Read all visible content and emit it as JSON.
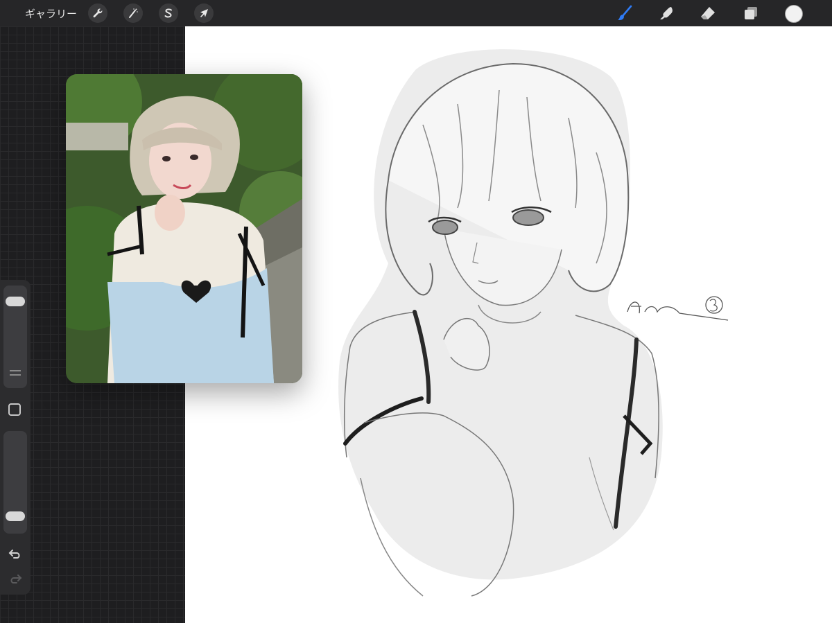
{
  "app": {
    "gallery_label": "ギャラリー"
  },
  "toolbar_left": [
    {
      "name": "actions-button",
      "icon": "wrench-icon"
    },
    {
      "name": "adjustments-button",
      "icon": "magic-wand-icon"
    },
    {
      "name": "selection-button",
      "icon": "selection-s-icon"
    },
    {
      "name": "transform-button",
      "icon": "arrow-cursor-icon"
    }
  ],
  "toolbar_right": [
    {
      "name": "brush-button",
      "icon": "brush-icon",
      "active_color": "#2f7bf5"
    },
    {
      "name": "smudge-button",
      "icon": "smudge-finger-icon"
    },
    {
      "name": "eraser-button",
      "icon": "eraser-icon"
    },
    {
      "name": "layers-button",
      "icon": "layers-icon"
    },
    {
      "name": "color-button",
      "icon": "color-swatch",
      "current_color": "#f2f2f2"
    }
  ],
  "sidebar": {
    "brush_size_level": 0.95,
    "opacity_level": 0.05,
    "controls": [
      "brush-size-slider",
      "modify-button",
      "opacity-slider",
      "undo-icon",
      "redo-icon"
    ]
  },
  "canvas": {
    "background_color": "#ffffff",
    "reference_window": "photo-reference",
    "drawing": "grayscale-girl-sketch",
    "signature_text": "Aya"
  }
}
